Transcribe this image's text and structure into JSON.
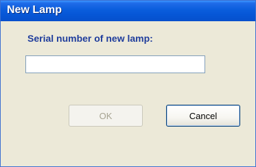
{
  "dialog": {
    "title": "New Lamp",
    "serial_label": "Serial number of new lamp:",
    "serial_value": "",
    "ok_label": "OK",
    "ok_enabled": false,
    "cancel_label": "Cancel"
  }
}
